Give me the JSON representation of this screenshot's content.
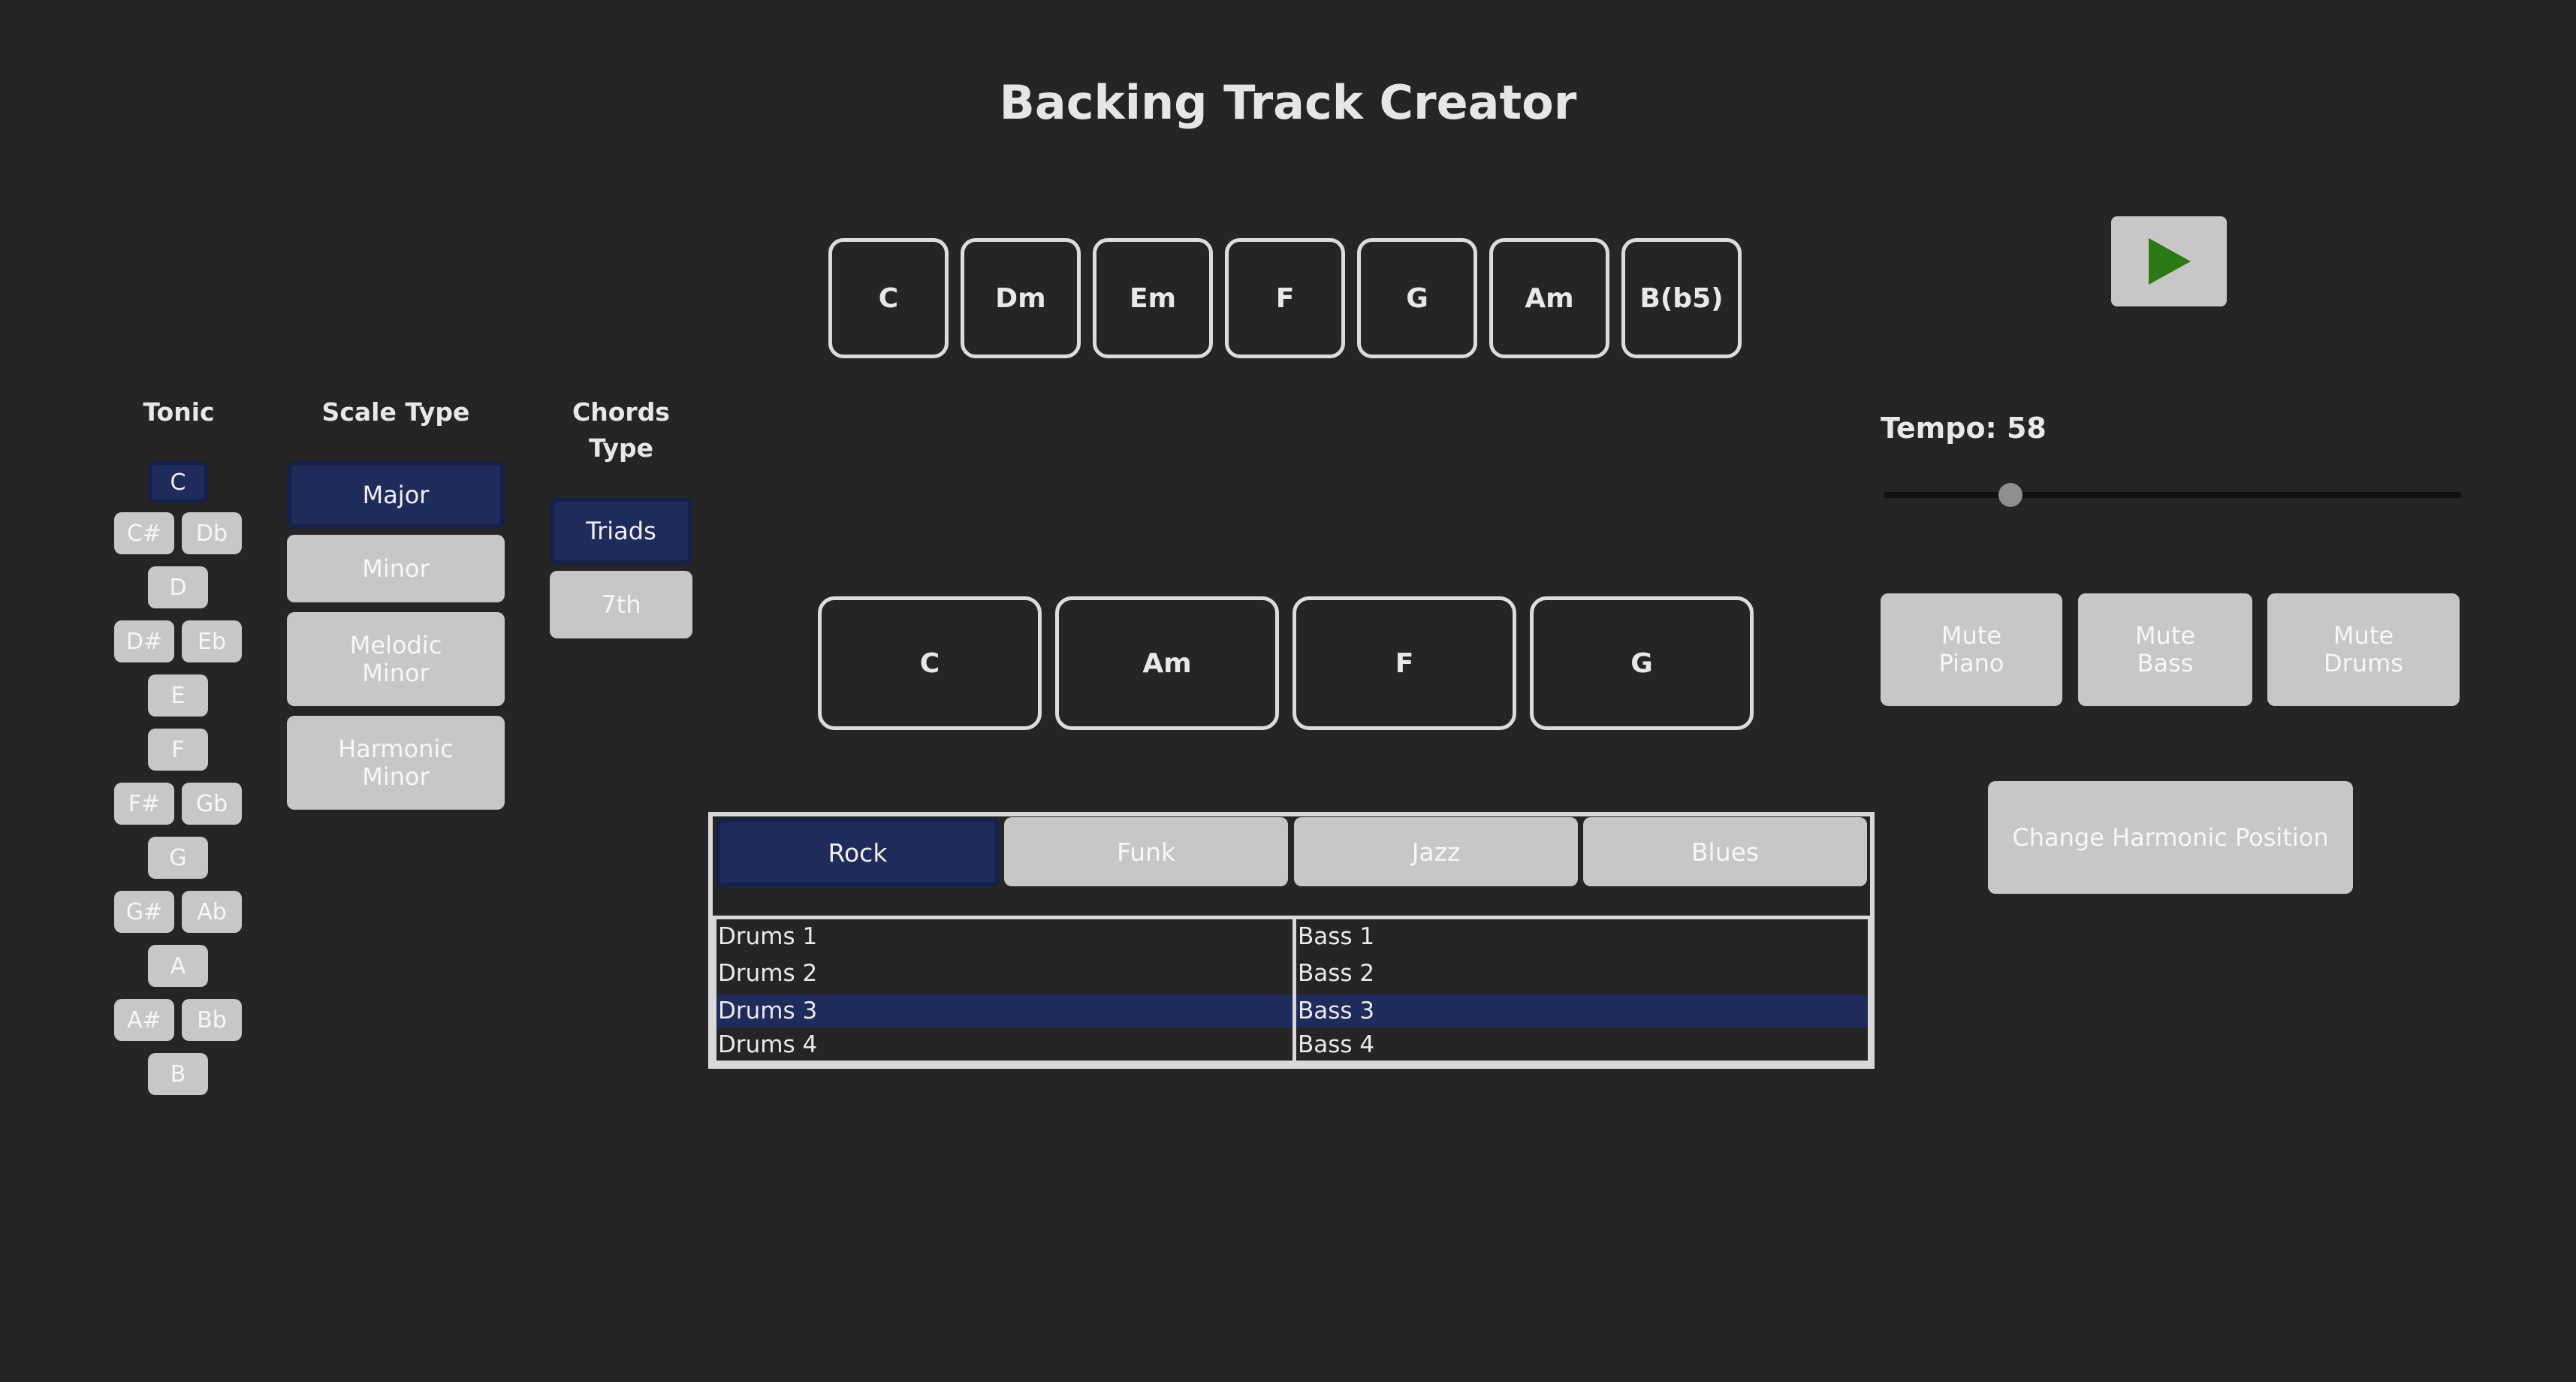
{
  "app": {
    "title": "Backing Track Creator"
  },
  "chord_palette": [
    "C",
    "Dm",
    "Em",
    "F",
    "G",
    "Am",
    "B(b5)"
  ],
  "play_button": {
    "icon": "play-icon",
    "color": "#2b7a15"
  },
  "tonic": {
    "header": "Tonic",
    "selected": "C",
    "notes": [
      "C",
      "C#",
      "Db",
      "D",
      "D#",
      "Eb",
      "E",
      "F",
      "F#",
      "Gb",
      "G",
      "G#",
      "Ab",
      "A",
      "A#",
      "Bb",
      "B"
    ]
  },
  "scale_type": {
    "header": "Scale Type",
    "options": [
      "Major",
      "Minor",
      "Melodic Minor",
      "Harmonic Minor"
    ],
    "selected": "Major"
  },
  "chords_type": {
    "header": "Chords Type",
    "options": [
      "Triads",
      "7th"
    ],
    "selected": "Triads"
  },
  "progression": [
    "C",
    "Am",
    "F",
    "G"
  ],
  "tempo": {
    "label": "Tempo: 58",
    "value": 58,
    "slider_fraction": 0.22
  },
  "mute_buttons": [
    "Mute Piano",
    "Mute Bass",
    "Mute Drums"
  ],
  "harmonic_button": "Change Harmonic Position",
  "styles": {
    "tabs": [
      "Rock",
      "Funk",
      "Jazz",
      "Blues"
    ],
    "selected_tab": "Rock",
    "drums": [
      "Drums 1",
      "Drums 2",
      "Drums 3",
      "Drums 4"
    ],
    "bass": [
      "Bass 1",
      "Bass 2",
      "Bass 3",
      "Bass 4"
    ],
    "selected_drums": "Drums 3",
    "selected_bass": "Bass 3"
  },
  "colors": {
    "background": "#252525",
    "selected": "#1e2b5b",
    "button": "#c7c7c7",
    "play": "#2b7a15"
  }
}
